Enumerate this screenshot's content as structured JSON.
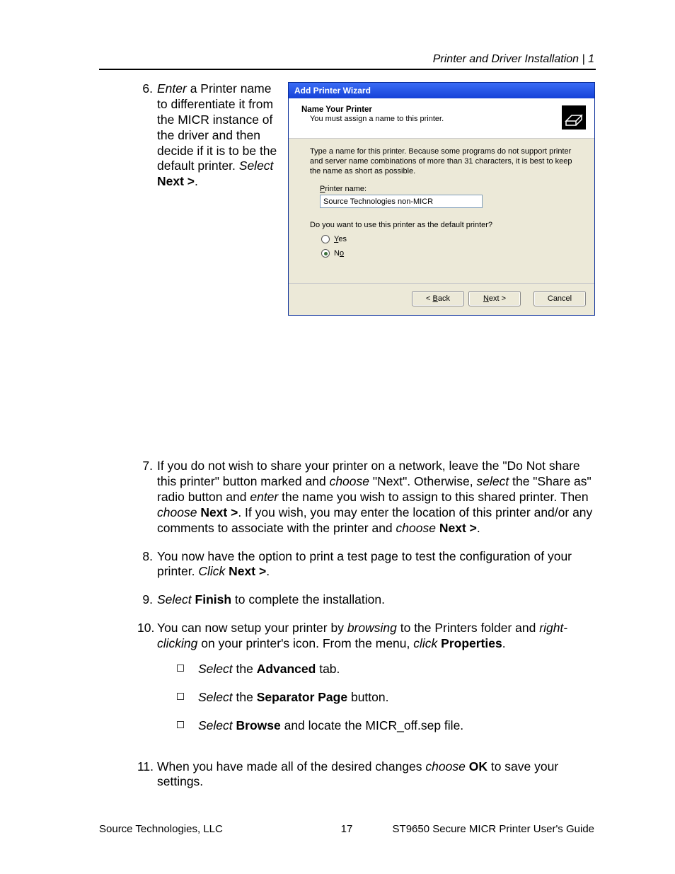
{
  "header": {
    "section": "Printer and Driver Installation  |  1"
  },
  "steps": {
    "s6": {
      "num": "6.",
      "text_html": "<em>Enter</em> a Printer name to differentiate it from the MICR instance of the driver and then decide if it is to be the default printer. <em>Select</em> <b>Next &gt;</b>."
    },
    "s7": {
      "num": "7.",
      "text_html": "If you do not wish to share your printer on a network, leave the \"Do Not share this printer\" button marked and <em>choose</em> \"Next\". Otherwise, <em>select</em> the \"Share as\" radio button and <em>enter</em> the name you wish to assign to this shared printer. Then <em>choose</em> <b>Next &gt;</b>. If you wish, you may enter the location of this printer and/or any comments to associate with the printer and <em>choose</em> <b>Next &gt;</b>."
    },
    "s8": {
      "num": "8.",
      "text_html": "You now have the option to print a test page to test the configuration of your printer. <em>Click</em> <b>Next &gt;</b>."
    },
    "s9": {
      "num": "9.",
      "text_html": "<em>Select</em> <b>Finish</b> to complete the installation."
    },
    "s10": {
      "num": "10.",
      "text_html": "You can now setup your printer by <em>browsing</em> to the Printers folder and <em>right-clicking</em> on your printer's icon.  From the menu, <em>click</em> <b>Properties</b>.",
      "checks": [
        "<em>Select</em> the <b>Advanced</b> tab.",
        "<em>Select</em> the <b>Separator Page</b> button.",
        "<em>Select</em> <b>Browse</b> and locate the MICR_off.sep file."
      ]
    },
    "s11": {
      "num": "11.",
      "text_html": "When you have made all of the desired changes <em>choose</em> <b>OK</b> to save your settings."
    }
  },
  "wizard": {
    "title": "Add Printer Wizard",
    "header_title": "Name Your Printer",
    "header_sub": "You must assign a name to this printer.",
    "desc": "Type a name for this printer. Because some programs do not support printer and server name combinations of more than 31 characters, it is best to keep the name as short as possible.",
    "printer_name_label_html": "<span class='underline-first'>P</span>rinter name:",
    "printer_name_value": "Source Technologies non-MICR",
    "default_question": "Do you want to use this printer as the default printer?",
    "yes_html": "<span class='underline-first'>Y</span>es",
    "no_html": "N<span class='underline-first'>o</span>",
    "btn_back_html": "&lt; <span class='underline-first'>B</span>ack",
    "btn_next_html": "<span class='underline-first'>N</span>ext &gt;",
    "btn_cancel": "Cancel"
  },
  "footer": {
    "left": "Source Technologies, LLC",
    "center": "17",
    "right": "ST9650 Secure MICR Printer User's Guide"
  }
}
